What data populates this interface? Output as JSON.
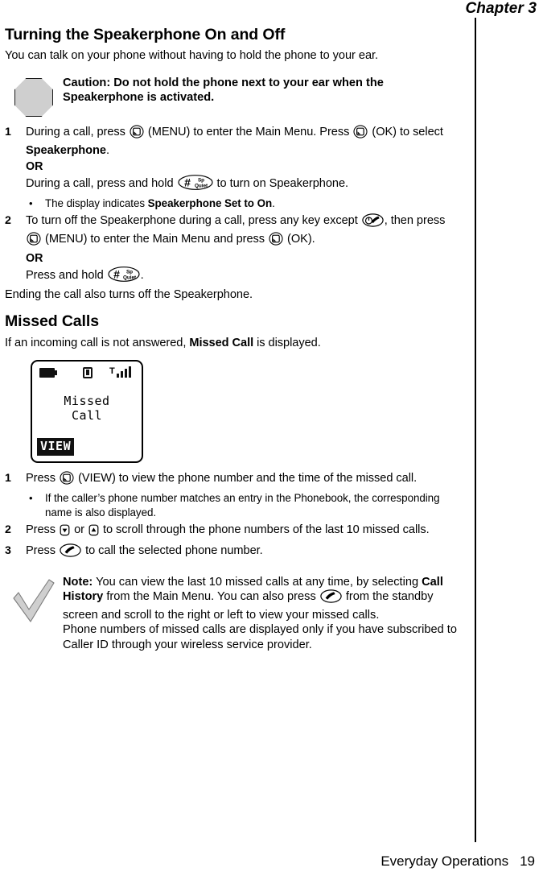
{
  "header": {
    "chapter": "Chapter 3"
  },
  "sections": {
    "speakerphone": {
      "title": "Turning the Speakerphone On and Off",
      "intro": "You can talk on your phone without having to hold the phone to your ear.",
      "caution": {
        "icon": "octagon-stop-icon",
        "label": "Caution:",
        "text": " Do not hold the phone next to your ear when the Speakerphone is activated."
      },
      "steps": [
        {
          "num": "1",
          "line1_a": "During a call, press ",
          "line1_b": " (MENU) to enter the Main Menu. Press ",
          "line1_c": " (OK) to select ",
          "line1_bold": "Speakerphone",
          "line1_d": ".",
          "or": "OR",
          "line2_a": "During a call, press and hold ",
          "line2_b": " to turn on Speakerphone.",
          "bullet_a": "The display indicates ",
          "bullet_bold": "Speakerphone Set to On",
          "bullet_b": "."
        },
        {
          "num": "2",
          "line1_a": "To turn off the Speakerphone during a call, press any key except ",
          "line1_b": ", then press ",
          "line1_c": " (MENU) to enter the Main Menu and press ",
          "line1_d": " (OK).",
          "or": "OR",
          "line2_a": "Press and hold ",
          "line2_b": "."
        }
      ],
      "closing": "Ending the call also turns off the Speakerphone."
    },
    "missed_calls": {
      "title": "Missed Calls",
      "intro_a": "If an incoming call is not answered, ",
      "intro_bold": "Missed Call",
      "intro_b": " is displayed.",
      "phone_screen": {
        "battery_icon": "battery-icon",
        "message_icon": "envelope-icon",
        "signal_icon": "signal-bars-icon",
        "line1": "Missed",
        "line2": "Call",
        "softkey_label": "VIEW"
      },
      "steps": [
        {
          "num": "1",
          "line1_a": "Press ",
          "line1_b": " (VIEW) to view the phone number and the time of the missed call.",
          "bullet": "If the caller’s phone number matches an entry in the Phonebook, the corresponding name is also displayed."
        },
        {
          "num": "2",
          "line1_a": "Press ",
          "line1_b": " or ",
          "line1_c": " to scroll through the phone numbers of the last 10 missed calls."
        },
        {
          "num": "3",
          "line1_a": "Press ",
          "line1_b": " to call the selected phone number."
        }
      ],
      "note": {
        "icon": "checkmark-icon",
        "label": "Note:",
        "text_a": " You can view the last 10 missed calls at any time, by selecting ",
        "text_bold": "Call History",
        "text_b": " from the Main Menu. You can also press ",
        "text_c": " from the standby screen and scroll to the right or left to view your missed calls.",
        "text_d": "Phone numbers of missed calls are displayed only if you have subscribed to Caller ID through your wireless service provider."
      }
    }
  },
  "footer": {
    "running_title": "Everyday Operations",
    "page_number": "19"
  },
  "colors": {
    "text": "#000000",
    "icon_fill": "#cfcfcf",
    "rule": "#000000"
  }
}
